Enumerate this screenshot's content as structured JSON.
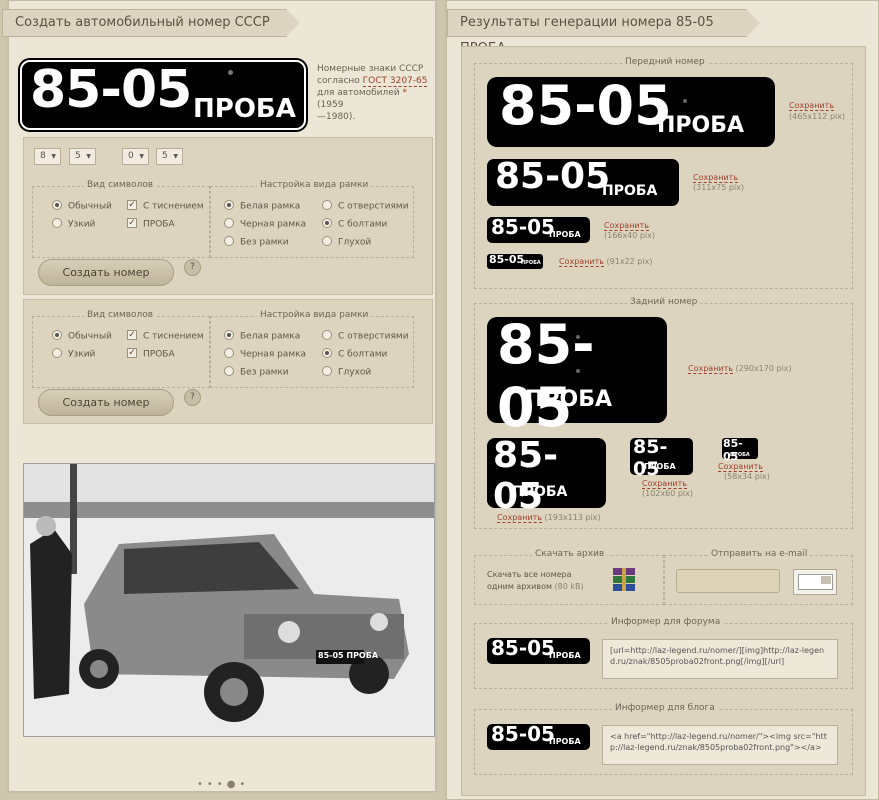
{
  "left": {
    "title": "Создать автомобильный номер СССР",
    "main_plate": {
      "number": "85-05",
      "word": "ПРОБА"
    },
    "info": {
      "line1": "Номерные знаки СССР",
      "line2_prefix": "согласно ",
      "gost": "ГОСТ 3207-65",
      "line3": "для автомобилей ",
      "star": "*",
      "years_a": " (1959",
      "years_b": "—1980)."
    },
    "selects": [
      "8",
      "5",
      "0",
      "5"
    ],
    "form1": {
      "symbols_title": "Вид символов",
      "frame_title": "Настройка вида рамки",
      "options": {
        "normal": "Обычный",
        "narrow": "Узкий",
        "embossed": "С тиснением",
        "proba": "ПРОБА",
        "white_frame": "Белая рамка",
        "black_frame": "Черная рамка",
        "no_frame": "Без рамки",
        "holes": "С отверстиями",
        "bolts": "С болтами",
        "blind": "Глухой"
      },
      "button": "Создать номер",
      "help": "?"
    },
    "form2": {
      "symbols_title": "Вид символов",
      "frame_title": "Настройка вида рамки",
      "options": {
        "normal": "Обычный",
        "narrow": "Узкий",
        "embossed": "С тиснением",
        "proba": "ПРОБА",
        "white_frame": "Белая рамка",
        "black_frame": "Черная рамка",
        "no_frame": "Без рамки",
        "holes": "С отверстиями",
        "bolts": "С болтами",
        "blind": "Глухой"
      },
      "button": "Создать номер",
      "help": "?"
    },
    "photo_plate": "85-05 ПРОБА"
  },
  "right": {
    "title": "Результаты генерации номера 85-05 ПРОБА",
    "front_title": "Передний номер",
    "rear_title": "Задний номер",
    "plate": {
      "number": "85-05",
      "word": "ПРОБА"
    },
    "save": "Сохранить",
    "front_sizes": [
      "(465x112 pix)",
      "(311x75 pix)",
      "(166x40 pix)",
      "(91x22 pix)"
    ],
    "rear_sizes": [
      "(290x170 pix)",
      "(193x113 pix)",
      "(102x60 pix)",
      "(58x34 pix)"
    ],
    "archive": {
      "title": "Скачать архив",
      "text1": "Скачать все номера",
      "text2": "одним архивом",
      "size": "(80 kB)"
    },
    "email_title": "Отправить на e-mail",
    "forum": {
      "title": "Информер для форума",
      "code": "[url=http://laz-legend.ru/nomer/][img]http://laz-legend.ru/znak/8505proba02front.png[/img][/url]"
    },
    "blog": {
      "title": "Информер для блога",
      "code": "<a href=\"http://laz-legend.ru/nomer/\"><img src=\"http://laz-legend.ru/znak/8505proba02front.png\"></a>"
    }
  }
}
